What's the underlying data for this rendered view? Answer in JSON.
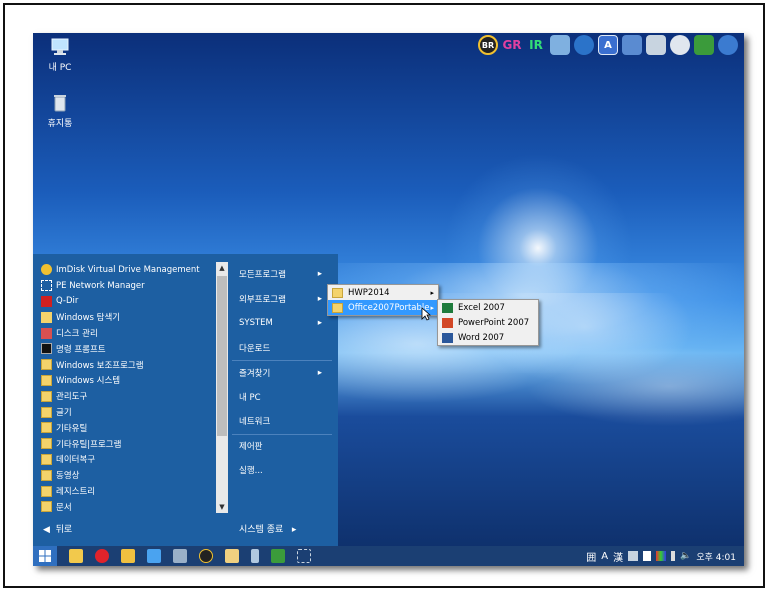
{
  "desktop": {
    "icons": [
      {
        "label": "내 PC",
        "icon": "computer-icon"
      },
      {
        "label": "휴지통",
        "icon": "recycle-bin-icon"
      }
    ],
    "top_icons": [
      {
        "label": "BR",
        "icon": "br-icon",
        "color": "#222222"
      },
      {
        "label": "GR",
        "icon": "gr-icon",
        "color": "#e040a0"
      },
      {
        "label": "IR",
        "icon": "ir-icon",
        "color": "#33cc66"
      },
      {
        "label": "",
        "icon": "network-tool-icon",
        "color": "#7fb0e0"
      },
      {
        "label": "",
        "icon": "globe-icon",
        "color": "#2b73c9"
      },
      {
        "label": "",
        "icon": "app-a-icon",
        "color": "#3a6fd0"
      },
      {
        "label": "",
        "icon": "disk-tool-icon",
        "color": "#5a8bd1"
      },
      {
        "label": "",
        "icon": "drive-icon",
        "color": "#c8d4e0"
      },
      {
        "label": "",
        "icon": "satellite-icon",
        "color": "#e0e6ee"
      },
      {
        "label": "",
        "icon": "monitor-icon",
        "color": "#3b9b3b"
      },
      {
        "label": "",
        "icon": "backup-icon",
        "color": "#3b7bd0"
      }
    ]
  },
  "start_menu": {
    "programs": [
      {
        "label": "ImDisk Virtual Drive Management",
        "icon": "imdisk-icon"
      },
      {
        "label": "PE Network Manager",
        "icon": "network-manager-icon"
      },
      {
        "label": "Q-Dir",
        "icon": "qdir-icon"
      },
      {
        "label": "Windows 탐색기",
        "icon": "explorer-icon"
      },
      {
        "label": "디스크 관리",
        "icon": "disk-management-icon"
      },
      {
        "label": "명령 프롬프트",
        "icon": "cmd-icon"
      },
      {
        "label": "Windows 보조프로그램",
        "icon": "folder-icon"
      },
      {
        "label": "Windows 시스템",
        "icon": "folder-icon"
      },
      {
        "label": "관리도구",
        "icon": "folder-icon"
      },
      {
        "label": "글기",
        "icon": "folder-icon"
      },
      {
        "label": "기타유틸",
        "icon": "folder-icon"
      },
      {
        "label": "기타유틸|프로그램",
        "icon": "folder-icon"
      },
      {
        "label": "데이터복구",
        "icon": "folder-icon"
      },
      {
        "label": "동영상",
        "icon": "folder-icon"
      },
      {
        "label": "레지스트리",
        "icon": "folder-icon"
      },
      {
        "label": "문서",
        "icon": "folder-icon"
      }
    ],
    "back_label": "뒤로",
    "right_items": [
      {
        "label": "모든프로그램",
        "arrow": "▸"
      },
      {
        "label": "외부프로그램",
        "arrow": "▸"
      },
      {
        "label": "SYSTEM",
        "arrow": "▸"
      },
      {
        "label": "다운로드",
        "arrow": ""
      },
      {
        "label": "즐겨찾기",
        "arrow": "▸"
      },
      {
        "label": "내 PC",
        "arrow": ""
      },
      {
        "label": "네트워크",
        "arrow": ""
      },
      {
        "label": "제어판",
        "arrow": ""
      },
      {
        "label": "실행...",
        "arrow": ""
      }
    ],
    "shutdown_label": "시스템 종료",
    "shutdown_arrow": "▸"
  },
  "flyout1": {
    "items": [
      {
        "label": "HWP2014",
        "arrow": "▸"
      },
      {
        "label": "Office2007Portable",
        "arrow": "▸"
      }
    ]
  },
  "flyout2": {
    "items": [
      {
        "label": "Excel 2007",
        "icon": "excel-icon",
        "color": "#1e7b3c"
      },
      {
        "label": "PowerPoint 2007",
        "icon": "powerpoint-icon",
        "color": "#d24726"
      },
      {
        "label": "Word 2007",
        "icon": "word-icon",
        "color": "#2b579a"
      }
    ]
  },
  "taskbar": {
    "pinned": [
      {
        "icon": "explorer-icon",
        "color": "#f2c94c"
      },
      {
        "icon": "opera-icon",
        "color": "#e0232b"
      },
      {
        "icon": "tool-icon",
        "color": "#f0c040"
      },
      {
        "icon": "windows-icon",
        "color": "#4aa3f0"
      },
      {
        "icon": "settings-icon",
        "color": "#9ab0c8"
      },
      {
        "icon": "br-icon",
        "color": "#222222"
      },
      {
        "icon": "hand-icon",
        "color": "#f0d080"
      },
      {
        "icon": "phone-icon",
        "color": "#b0c8e0"
      },
      {
        "icon": "monitor-icon",
        "color": "#3b9b3b"
      },
      {
        "icon": "fullscreen-icon",
        "color": "#c8d4e0"
      }
    ],
    "tray": {
      "ime_icons": [
        "囲",
        "A",
        "漢"
      ],
      "clock": "오후 4:01"
    }
  }
}
